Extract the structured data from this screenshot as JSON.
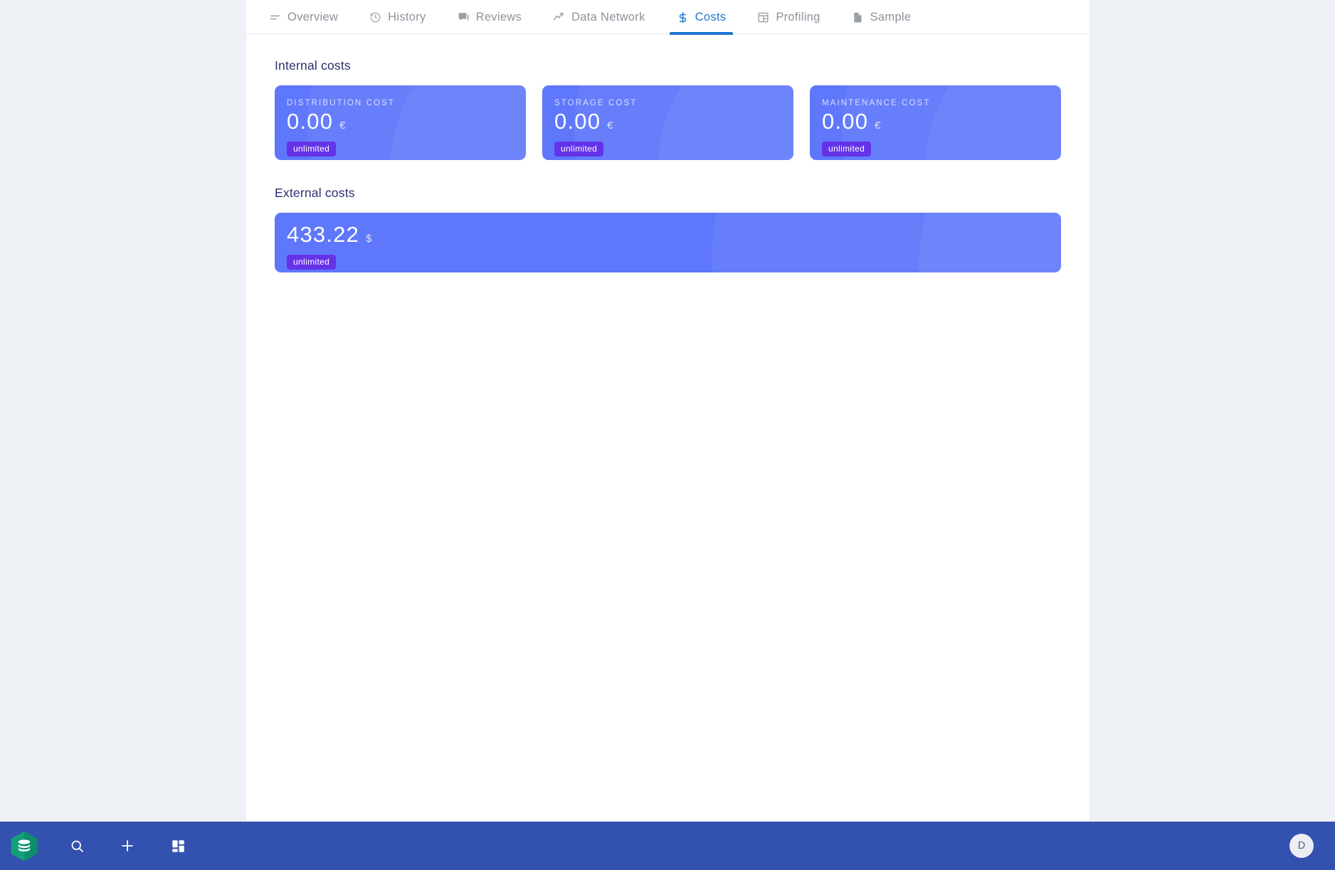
{
  "tabs": [
    {
      "label": "Overview",
      "icon": "list-icon",
      "active": false
    },
    {
      "label": "History",
      "icon": "clock-history-icon",
      "active": false
    },
    {
      "label": "Reviews",
      "icon": "chat-icon",
      "active": false
    },
    {
      "label": "Data Network",
      "icon": "trending-up-icon",
      "active": false
    },
    {
      "label": "Costs",
      "icon": "dollar-icon",
      "active": true
    },
    {
      "label": "Profiling",
      "icon": "table-grid-icon",
      "active": false
    },
    {
      "label": "Sample",
      "icon": "document-icon",
      "active": false
    }
  ],
  "internal": {
    "heading": "Internal costs",
    "cards": [
      {
        "title": "DISTRIBUTION COST",
        "value": "0.00",
        "unit": "€",
        "badge": "unlimited"
      },
      {
        "title": "STORAGE COST",
        "value": "0.00",
        "unit": "€",
        "badge": "unlimited"
      },
      {
        "title": "MAINTENANCE COST",
        "value": "0.00",
        "unit": "€",
        "badge": "unlimited"
      }
    ]
  },
  "external": {
    "heading": "External costs",
    "card": {
      "value": "433.22",
      "unit": "$",
      "badge": "unlimited"
    }
  },
  "appbar": {
    "logo_icon": "stacked-layers-logo",
    "buttons": [
      {
        "icon": "search-icon"
      },
      {
        "icon": "plus-icon"
      },
      {
        "icon": "dashboard-grid-icon"
      }
    ],
    "avatar_initial": "D"
  },
  "colors": {
    "page_background": "#eef1f6",
    "panel_background": "#ffffff",
    "accent_tab_active": "#1e76d2",
    "card_background": "#5f77fb",
    "badge_background": "#6433e8",
    "appbar_background": "#3351ae",
    "heading_text": "#2b2f6e"
  }
}
